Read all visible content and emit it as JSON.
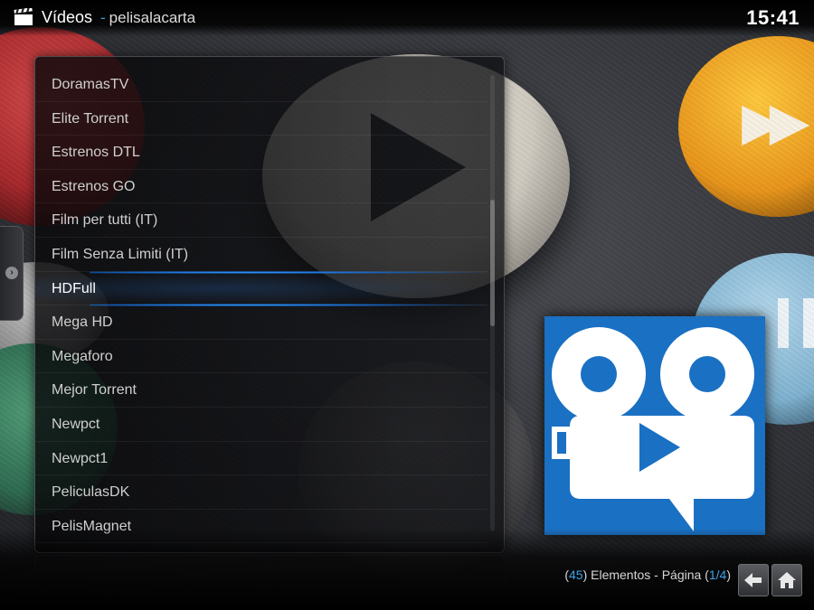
{
  "header": {
    "icon": "clapperboard-icon",
    "title": "Vídeos",
    "separator": "-",
    "subtitle": "pelisalacarta",
    "clock": "15:41"
  },
  "side_tab": {
    "icon": "chevron-right-icon"
  },
  "list": {
    "items": [
      {
        "label": "DoramasTV"
      },
      {
        "label": "Elite Torrent"
      },
      {
        "label": "Estrenos DTL"
      },
      {
        "label": "Estrenos GO"
      },
      {
        "label": "Film per tutti (IT)"
      },
      {
        "label": "Film Senza Limiti (IT)"
      },
      {
        "label": "HDFull"
      },
      {
        "label": "Mega HD"
      },
      {
        "label": "Megaforo"
      },
      {
        "label": "Mejor Torrent"
      },
      {
        "label": "Newpct"
      },
      {
        "label": "Newpct1"
      },
      {
        "label": "PeliculasDK"
      },
      {
        "label": "PelisMagnet"
      }
    ],
    "selected_index": 6
  },
  "thumbnail": {
    "icon": "video-camera-play-icon",
    "background": "#1a70c2"
  },
  "footer": {
    "open_paren": "(",
    "count": "45",
    "items_label": ") Elementos - Página (",
    "page": "1/4",
    "close_paren": ")",
    "back_icon": "arrow-left-icon",
    "home_icon": "home-icon"
  },
  "colors": {
    "accent": "#3ba3e8",
    "highlight": "#1e7fe0"
  }
}
